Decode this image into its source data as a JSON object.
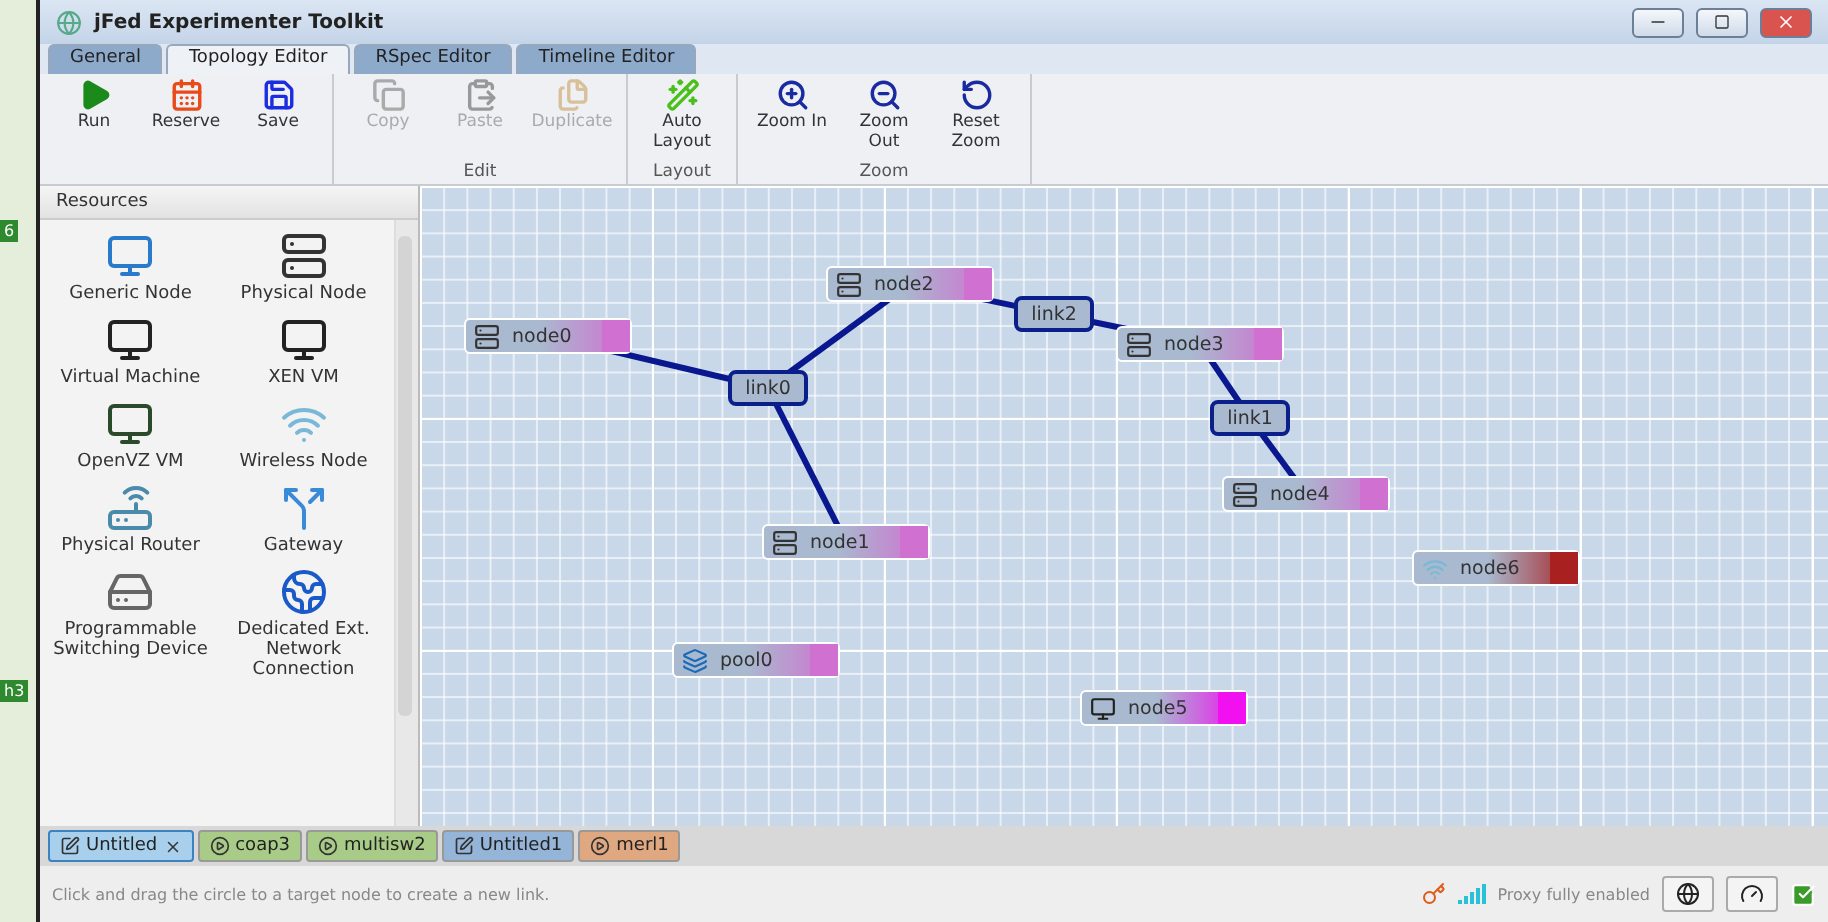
{
  "background_fragments": [
    "6",
    "h3"
  ],
  "window": {
    "title": "jFed Experimenter Toolkit"
  },
  "tabs": [
    {
      "label": "General",
      "selected": false
    },
    {
      "label": "Topology Editor",
      "selected": true
    },
    {
      "label": "RSpec Editor",
      "selected": false
    },
    {
      "label": "Timeline Editor",
      "selected": false
    }
  ],
  "ribbon": [
    {
      "buttons": [
        {
          "kind": "run",
          "label": "Run",
          "disabled": false
        },
        {
          "kind": "reserve",
          "label": "Reserve",
          "disabled": false
        },
        {
          "kind": "save",
          "label": "Save",
          "disabled": false
        }
      ]
    },
    {
      "label": "Edit",
      "buttons": [
        {
          "kind": "copy",
          "label": "Copy",
          "disabled": true
        },
        {
          "kind": "paste",
          "label": "Paste",
          "disabled": true
        },
        {
          "kind": "duplicate",
          "label": "Duplicate",
          "disabled": true
        }
      ]
    },
    {
      "label": "Layout",
      "buttons": [
        {
          "kind": "auto",
          "label": "Auto Layout",
          "disabled": false
        }
      ]
    },
    {
      "label": "Zoom",
      "buttons": [
        {
          "kind": "zoomin",
          "label": "Zoom In",
          "disabled": false
        },
        {
          "kind": "zoomout",
          "label": "Zoom Out",
          "disabled": false
        },
        {
          "kind": "reset",
          "label": "Reset Zoom",
          "disabled": false
        }
      ]
    }
  ],
  "sidebar": {
    "title": "Resources",
    "items": [
      {
        "kind": "generic",
        "label": "Generic Node"
      },
      {
        "kind": "physical",
        "label": "Physical Node"
      },
      {
        "kind": "vm",
        "label": "Virtual Machine"
      },
      {
        "kind": "xen",
        "label": "XEN VM"
      },
      {
        "kind": "openvz",
        "label": "OpenVZ VM"
      },
      {
        "kind": "wireless",
        "label": "Wireless Node"
      },
      {
        "kind": "router",
        "label": "Physical Router"
      },
      {
        "kind": "gateway",
        "label": "Gateway"
      },
      {
        "kind": "switch",
        "label": "Programmable Switching Device"
      },
      {
        "kind": "network",
        "label": "Dedicated Ext. Network Connection"
      }
    ]
  },
  "canvas": {
    "nodes": [
      {
        "kind": "physical",
        "label": "node0",
        "color": "#d070d0"
      },
      {
        "kind": "physical",
        "label": "node2",
        "color": "#d070d0"
      },
      {
        "kind": "physical",
        "label": "node3",
        "color": "#d070d0"
      },
      {
        "kind": "physical",
        "label": "node4",
        "color": "#d070d0"
      },
      {
        "kind": "physical",
        "label": "node1",
        "color": "#d070d0"
      },
      {
        "kind": "wireless",
        "label": "node6",
        "color": "#a82020"
      },
      {
        "kind": "pool",
        "label": "pool0",
        "color": "#d070d0"
      },
      {
        "kind": "xen",
        "label": "node5",
        "color": "#f010f0"
      }
    ],
    "links": [
      {
        "label": "link0"
      },
      {
        "label": "link2"
      },
      {
        "label": "link1"
      }
    ]
  },
  "document_tabs": [
    {
      "kind": "edit",
      "label": "Untitled",
      "selected": true,
      "closable": true,
      "color": "#a8d0ec"
    },
    {
      "kind": "play",
      "label": "coap3",
      "selected": false,
      "closable": false,
      "color": "#a8cc88"
    },
    {
      "kind": "play",
      "label": "multisw2",
      "selected": false,
      "closable": false,
      "color": "#a8cc88"
    },
    {
      "kind": "edit",
      "label": "Untitled1",
      "selected": false,
      "closable": false,
      "color": "#94b4d8"
    },
    {
      "kind": "play",
      "label": "merl1",
      "selected": false,
      "closable": false,
      "color": "#e0a880"
    }
  ],
  "status_bar": {
    "message": "Click and drag the circle to a target node to create a new link.",
    "proxy": "Proxy fully enabled",
    "ok": true
  }
}
